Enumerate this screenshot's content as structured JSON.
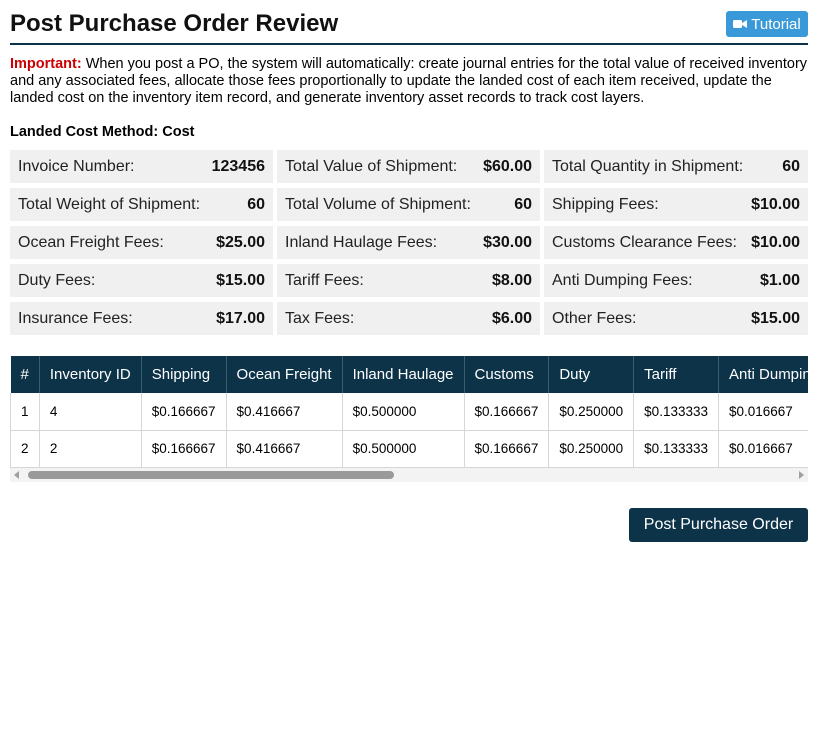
{
  "header": {
    "title": "Post Purchase Order Review",
    "tutorial_label": "Tutorial",
    "tutorial_icon": "video-camera-icon"
  },
  "notice": {
    "important_label": "Important:",
    "text": " When you post a PO, the system will automatically: create journal entries for the total value of received inventory and any associated fees, allocate those fees proportionally to update the landed cost of each item received, update the landed cost on the inventory item record, and generate inventory asset records to track cost layers."
  },
  "landed_cost_method": "Landed Cost Method: Cost",
  "summary": [
    {
      "label": "Invoice Number:",
      "value": "123456"
    },
    {
      "label": "Total Value of Shipment:",
      "value": "$60.00"
    },
    {
      "label": "Total Quantity in Shipment:",
      "value": "60"
    },
    {
      "label": "Total Weight of Shipment:",
      "value": "60"
    },
    {
      "label": "Total Volume of Shipment:",
      "value": "60"
    },
    {
      "label": "Shipping Fees:",
      "value": "$10.00"
    },
    {
      "label": "Ocean Freight Fees:",
      "value": "$25.00"
    },
    {
      "label": "Inland Haulage Fees:",
      "value": "$30.00"
    },
    {
      "label": "Customs Clearance Fees:",
      "value": "$10.00"
    },
    {
      "label": "Duty Fees:",
      "value": "$15.00"
    },
    {
      "label": "Tariff Fees:",
      "value": "$8.00"
    },
    {
      "label": "Anti Dumping Fees:",
      "value": "$1.00"
    },
    {
      "label": "Insurance Fees:",
      "value": "$17.00"
    },
    {
      "label": "Tax Fees:",
      "value": "$6.00"
    },
    {
      "label": "Other Fees:",
      "value": "$15.00"
    }
  ],
  "table": {
    "columns": [
      "#",
      "Inventory ID",
      "Shipping",
      "Ocean Freight",
      "Inland Haulage",
      "Customs",
      "Duty",
      "Tariff",
      "Anti Dumping"
    ],
    "rows": [
      [
        "1",
        "4",
        "$0.166667",
        "$0.416667",
        "$0.500000",
        "$0.166667",
        "$0.250000",
        "$0.133333",
        "$0.016667"
      ],
      [
        "2",
        "2",
        "$0.166667",
        "$0.416667",
        "$0.500000",
        "$0.166667",
        "$0.250000",
        "$0.133333",
        "$0.016667"
      ]
    ]
  },
  "actions": {
    "post_label": "Post Purchase Order"
  },
  "colors": {
    "navy": "#0d3349",
    "tutorial_blue": "#3a9ad9",
    "important_red": "#cc0000",
    "summary_bg": "#f0f0f0"
  }
}
